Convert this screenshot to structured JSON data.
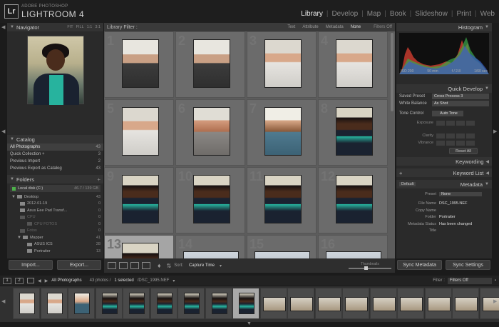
{
  "app": {
    "logo": "Lr",
    "vendor": "ADOBE PHOTOSHOP",
    "name": "LIGHTROOM 4"
  },
  "modules": [
    "Library",
    "Develop",
    "Map",
    "Book",
    "Slideshow",
    "Print",
    "Web"
  ],
  "active_module": "Library",
  "navigator": {
    "title": "Navigator",
    "zoom": [
      "FIT",
      "FILL",
      "1:1",
      "3:1"
    ]
  },
  "catalog": {
    "title": "Catalog",
    "items": [
      {
        "label": "All Photographs",
        "count": "43"
      },
      {
        "label": "Quick Collection +",
        "count": "3"
      },
      {
        "label": "Previous Import",
        "count": "2"
      },
      {
        "label": "Previous Export as Catalog",
        "count": "43"
      }
    ]
  },
  "folders": {
    "title": "Folders",
    "disk": {
      "label": "Local disk (C:)",
      "info": "46.7 / 139 GB"
    },
    "items": [
      {
        "label": "Desktop",
        "count": "43"
      },
      {
        "label": "2012-01-19",
        "count": "0"
      },
      {
        "label": "Asus Eee Pad Transf...",
        "count": "0"
      },
      {
        "label": "CPU",
        "count": "0"
      },
      {
        "label": "CPU FOTOS",
        "count": "0"
      },
      {
        "label": "Fotos",
        "count": "0"
      },
      {
        "label": "Mapper",
        "count": "41"
      },
      {
        "label": "ASUS ICS",
        "count": "28"
      },
      {
        "label": "Portraiter",
        "count": "13"
      }
    ]
  },
  "left_buttons": {
    "import": "Import...",
    "export": "Export..."
  },
  "library_filter": {
    "title": "Library Filter :",
    "tabs": [
      "Text",
      "Attribute",
      "Metadata",
      "None"
    ],
    "active_tab": "None",
    "filters_off": "Filters Off"
  },
  "grid": {
    "cells": [
      {
        "num": "1",
        "kind": "man_tshirt"
      },
      {
        "num": "2",
        "kind": "man_tshirt"
      },
      {
        "num": "3",
        "kind": "man_white"
      },
      {
        "num": "4",
        "kind": "man_white"
      },
      {
        "num": "5",
        "kind": "man_white"
      },
      {
        "num": "6",
        "kind": "man_beard"
      },
      {
        "num": "7",
        "kind": "man_glasses"
      },
      {
        "num": "8",
        "kind": "woman"
      },
      {
        "num": "9",
        "kind": "woman"
      },
      {
        "num": "10",
        "kind": "woman"
      },
      {
        "num": "11",
        "kind": "woman"
      },
      {
        "num": "12",
        "kind": "woman"
      },
      {
        "num": "13",
        "kind": "woman"
      },
      {
        "num": "14",
        "kind": "wide"
      },
      {
        "num": "15",
        "kind": "wide"
      },
      {
        "num": "16",
        "kind": "wide"
      }
    ]
  },
  "toolbar": {
    "sort_label": "Sort:",
    "sort_value": "Capture Time",
    "thumbnails_label": "Thumbnails"
  },
  "histogram": {
    "title": "Histogram",
    "info": [
      "ISO 200",
      "50 mm",
      "f / 2.8",
      "1/60 sec"
    ]
  },
  "quick_develop": {
    "title": "Quick Develop",
    "saved_preset": {
      "label": "Saved Preset",
      "value": "Cross Process 3"
    },
    "white_balance": {
      "label": "White Balance",
      "value": "As Shot"
    },
    "tone_control": {
      "label": "Tone Control",
      "value": "Auto Tone"
    },
    "sliders": [
      "Exposure",
      "Clarity",
      "Vibrance"
    ],
    "reset": "Reset All"
  },
  "keywording": {
    "title": "Keywording"
  },
  "keyword_list": {
    "title": "Keyword List"
  },
  "metadata": {
    "title": "Metadata",
    "preset_dropdown": "Default",
    "rows": [
      {
        "label": "Preset",
        "value": "None"
      },
      {
        "label": "File Name",
        "value": "DSC_1995.NEF"
      },
      {
        "label": "Copy Name",
        "value": ""
      },
      {
        "label": "Folder",
        "value": "Portraiter"
      },
      {
        "label": "Metadata Status",
        "value": "Has been changed"
      },
      {
        "label": "Title",
        "value": ""
      }
    ]
  },
  "right_buttons": {
    "sync_metadata": "Sync Metadata",
    "sync_settings": "Sync Settings"
  },
  "filmstrip_bar": {
    "source": "All Photographs",
    "summary": "43 photos /",
    "selected": "1 selected",
    "filename": "/DSC_1995.NEF",
    "filter_label": "Filter :",
    "filter_value": "Filters Off"
  },
  "colors": {
    "accent": "#27b39e",
    "panel": "#2a2a2a",
    "grid_bg": "#5c5c5c",
    "cell": "#6b6b6b"
  }
}
